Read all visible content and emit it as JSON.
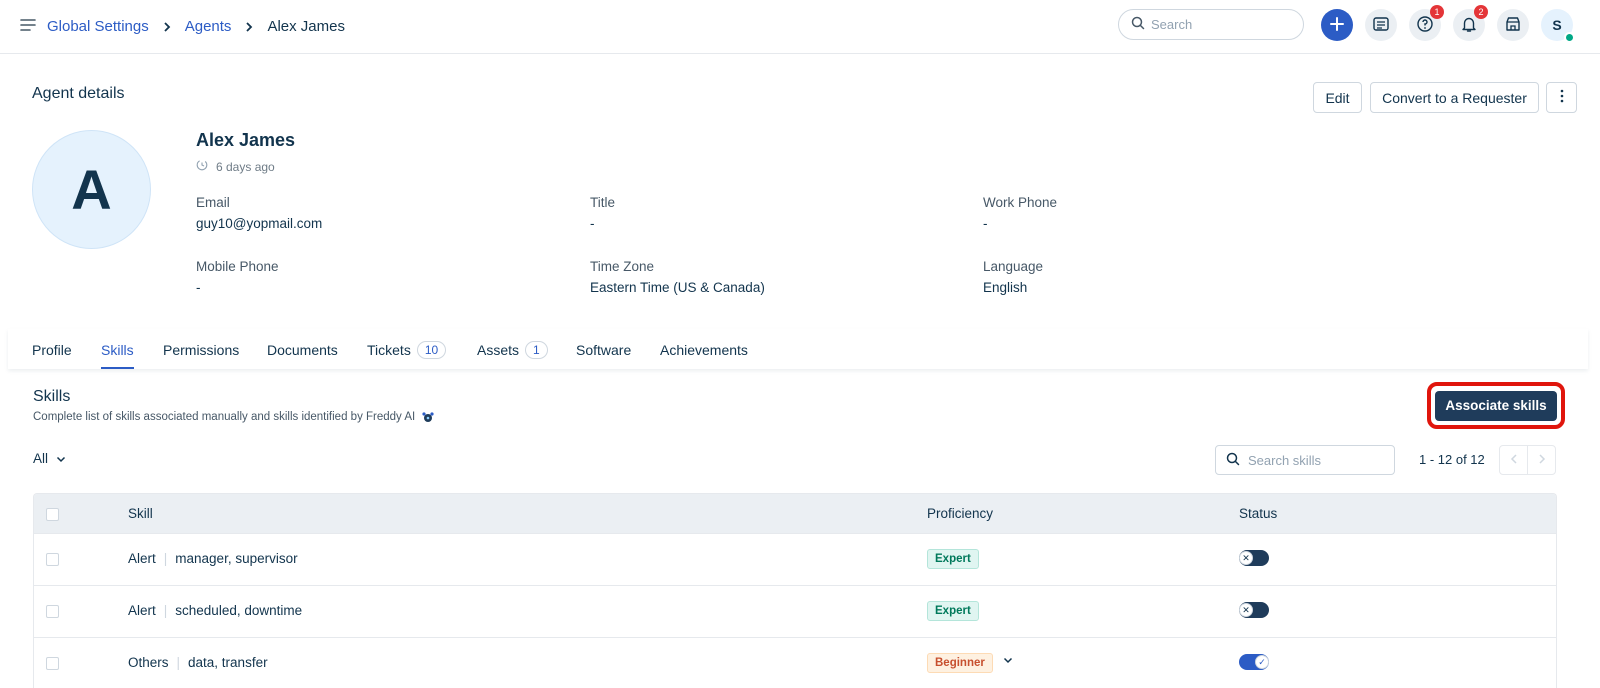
{
  "header": {
    "breadcrumb": [
      "Global Settings",
      "Agents"
    ],
    "current": "Alex James",
    "search_placeholder": "Search",
    "help_badge": "1",
    "notif_badge": "2",
    "user_initial": "S"
  },
  "agent": {
    "section_title": "Agent details",
    "edit_label": "Edit",
    "convert_label": "Convert to a Requester",
    "initial": "A",
    "name": "Alex James",
    "ago": "6 days ago",
    "fields": {
      "email_label": "Email",
      "email_value": "guy10@yopmail.com",
      "title_label": "Title",
      "title_value": "-",
      "work_phone_label": "Work Phone",
      "work_phone_value": "-",
      "mobile_label": "Mobile Phone",
      "mobile_value": "-",
      "timezone_label": "Time Zone",
      "timezone_value": "Eastern Time (US & Canada)",
      "language_label": "Language",
      "language_value": "English"
    }
  },
  "tabs": {
    "profile": "Profile",
    "skills": "Skills",
    "permissions": "Permissions",
    "documents": "Documents",
    "tickets": "Tickets",
    "tickets_count": "10",
    "assets": "Assets",
    "assets_count": "1",
    "software": "Software",
    "achievements": "Achievements",
    "active": "Skills"
  },
  "skills": {
    "title": "Skills",
    "subtitle": "Complete list of skills associated manually and skills identified by Freddy AI",
    "associate_label": "Associate skills",
    "filter": "All",
    "search_placeholder": "Search skills",
    "pager": "1 - 12 of 12",
    "columns": {
      "skill": "Skill",
      "proficiency": "Proficiency",
      "status": "Status"
    },
    "rows": [
      {
        "name": "Alert",
        "tags": "manager, supervisor",
        "proficiency": "Expert",
        "status": "off"
      },
      {
        "name": "Alert",
        "tags": "scheduled, downtime",
        "proficiency": "Expert",
        "status": "off"
      },
      {
        "name": "Others",
        "tags": "data, transfer",
        "proficiency": "Beginner",
        "status": "on"
      }
    ]
  },
  "colors": {
    "accent": "#2c5cc5",
    "primary_button": "#1f3c5b",
    "highlight": "#e0150c",
    "expert": "#00795b",
    "beginner": "#c7502f"
  }
}
